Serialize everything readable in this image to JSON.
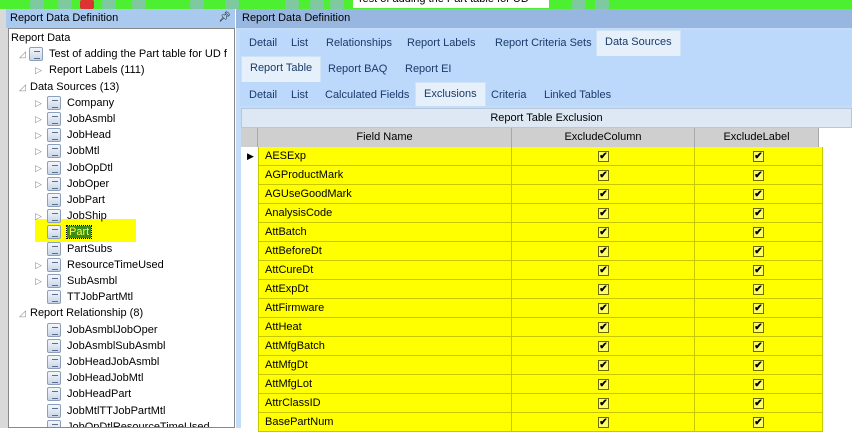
{
  "toolbar": {
    "record_input": "Test of adding the Part table for UD"
  },
  "left_panel": {
    "title": "Report Data Definition"
  },
  "tree": {
    "root": "Report Data",
    "report": "Test of adding the Part table for UD f",
    "report_labels": "Report Labels (111)",
    "data_sources": "Data Sources (13)",
    "sources": [
      {
        "label": "Company",
        "expandable": true
      },
      {
        "label": "JobAsmbl",
        "expandable": true
      },
      {
        "label": "JobHead",
        "expandable": true
      },
      {
        "label": "JobMtl",
        "expandable": true
      },
      {
        "label": "JobOpDtl",
        "expandable": true
      },
      {
        "label": "JobOper",
        "expandable": true
      },
      {
        "label": "JobPart",
        "expandable": false
      },
      {
        "label": "JobShip",
        "expandable": true
      },
      {
        "label": "Part",
        "expandable": false,
        "selected": true
      },
      {
        "label": "PartSubs",
        "expandable": false
      },
      {
        "label": "ResourceTimeUsed",
        "expandable": true
      },
      {
        "label": "SubAsmbl",
        "expandable": true
      },
      {
        "label": "TTJobPartMtl",
        "expandable": false
      }
    ],
    "relationships": "Report Relationship (8)",
    "relationship_items": [
      "JobAsmblJobOper",
      "JobAsmblSubAsmbl",
      "JobHeadJobAsmbl",
      "JobHeadJobMtl",
      "JobHeadPart",
      "JobMtlTTJobPartMtl",
      "JobOpDtlResourceTimeUsed"
    ]
  },
  "right_panel": {
    "title": "Report Data Definition"
  },
  "tabs1": [
    "Detail",
    "List",
    "Relationships",
    "Report Labels",
    "Report Criteria Sets",
    "Data Sources"
  ],
  "tabs2": [
    "Report Table",
    "Report BAQ",
    "Report EI"
  ],
  "tabs3": [
    "Detail",
    "List",
    "Calculated Fields",
    "Exclusions",
    "Criteria",
    "Linked Tables"
  ],
  "grid": {
    "caption": "Report Table Exclusion",
    "columns": [
      "Field Name",
      "ExcludeColumn",
      "ExcludeLabel"
    ],
    "rows": [
      {
        "field": "AESExp",
        "col": true,
        "label": true
      },
      {
        "field": "AGProductMark",
        "col": true,
        "label": true
      },
      {
        "field": "AGUseGoodMark",
        "col": true,
        "label": true
      },
      {
        "field": "AnalysisCode",
        "col": true,
        "label": true
      },
      {
        "field": "AttBatch",
        "col": true,
        "label": true
      },
      {
        "field": "AttBeforeDt",
        "col": true,
        "label": true
      },
      {
        "field": "AttCureDt",
        "col": true,
        "label": true
      },
      {
        "field": "AttExpDt",
        "col": true,
        "label": true
      },
      {
        "field": "AttFirmware",
        "col": true,
        "label": true
      },
      {
        "field": "AttHeat",
        "col": true,
        "label": true
      },
      {
        "field": "AttMfgBatch",
        "col": true,
        "label": true
      },
      {
        "field": "AttMfgDt",
        "col": true,
        "label": true
      },
      {
        "field": "AttMfgLot",
        "col": true,
        "label": true
      },
      {
        "field": "AttrClassID",
        "col": true,
        "label": true
      },
      {
        "field": "BasePartNum",
        "col": true,
        "label": true
      }
    ]
  },
  "colors": {
    "toolbar": "#4cf030",
    "highlight": "#ffff00",
    "tab_bg": "#bcd8fb"
  }
}
